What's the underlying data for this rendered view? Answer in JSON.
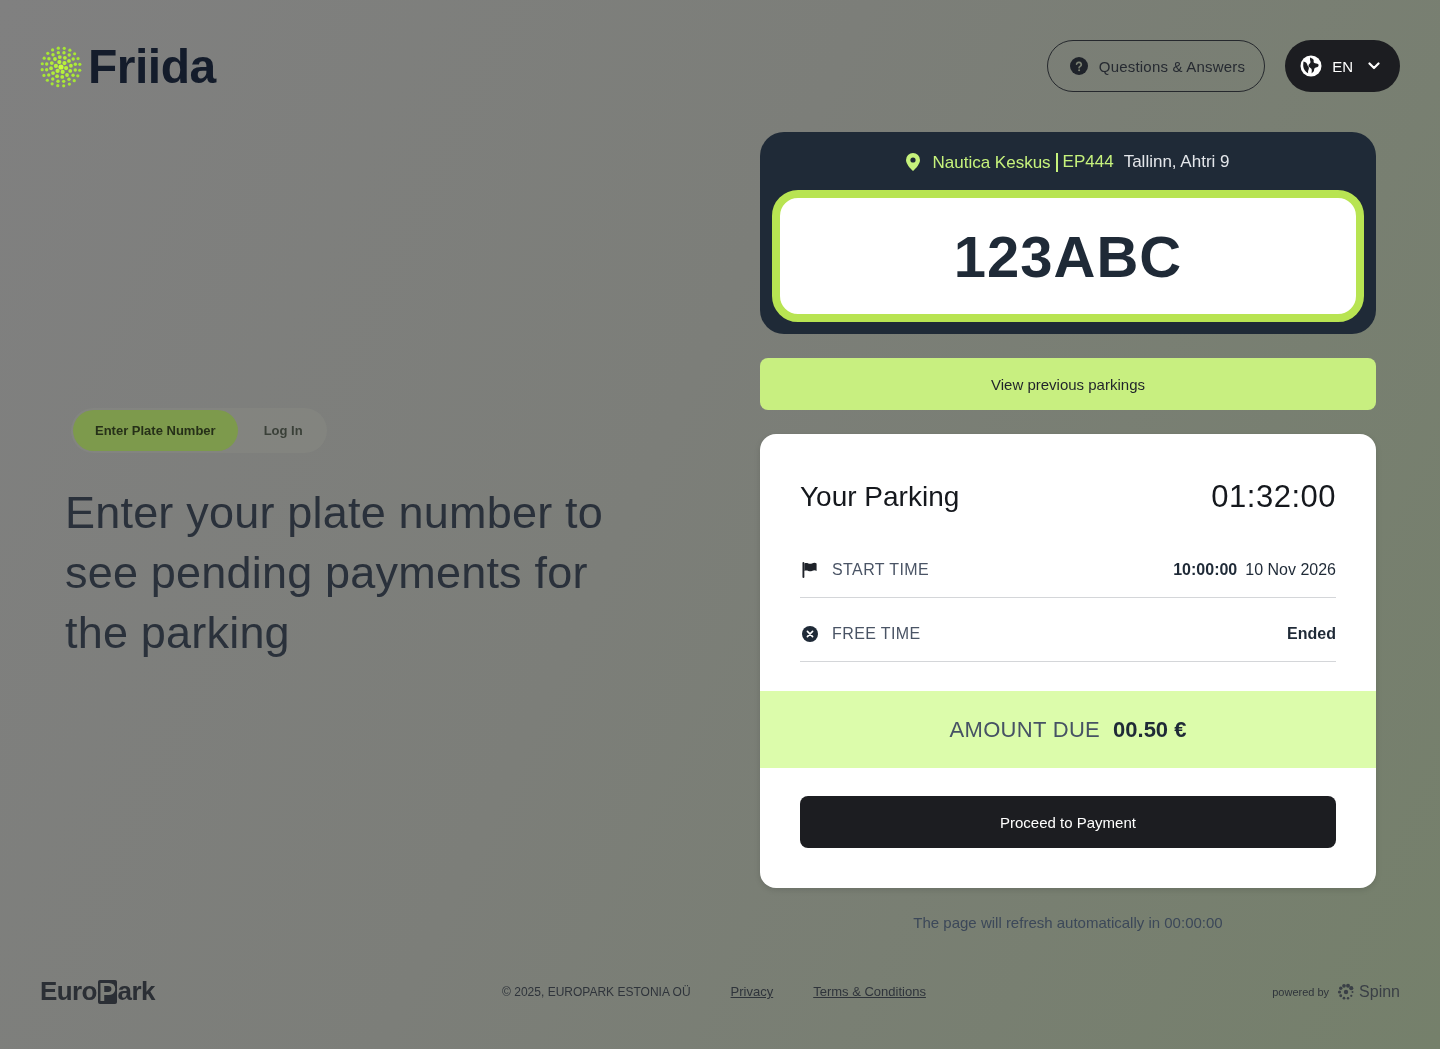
{
  "header": {
    "logo": "Friida",
    "help_button": "Questions & Answers",
    "language_button": "EN"
  },
  "background_page": {
    "tabs": [
      {
        "label": "Enter Plate Number",
        "selected": true
      },
      {
        "label": "Log In",
        "selected": false
      }
    ],
    "headline": "Enter your plate number to see pending payments for the parking"
  },
  "location": {
    "name": "Nautica Keskus",
    "code": "EP444",
    "address": "Tallinn, Ahtri 9"
  },
  "plate": "123ABC",
  "previous_button": "View previous parkings",
  "parking": {
    "title": "Your Parking",
    "duration": "01:32:00",
    "rows": [
      {
        "kind": "start",
        "label": "START TIME",
        "values": [
          "10:00:00",
          "10 Nov 2026"
        ]
      },
      {
        "kind": "free",
        "label": "FREE TIME",
        "values": [
          "Ended"
        ]
      }
    ],
    "amount_label": "AMOUNT DUE",
    "amount": "00.50 €",
    "pay_button": "Proceed to Payment"
  },
  "refresh_note": "The page will refresh automatically in 00:00:00",
  "footer": {
    "logo": {
      "before": "Euro",
      "boxed": "P",
      "after": "ark"
    },
    "copyright": "© 2025, EUROPARK ESTONIA OÜ",
    "links": [
      "Privacy",
      "Terms & Conditions"
    ],
    "powered_by": "powered by",
    "provider": "Spinn"
  }
}
